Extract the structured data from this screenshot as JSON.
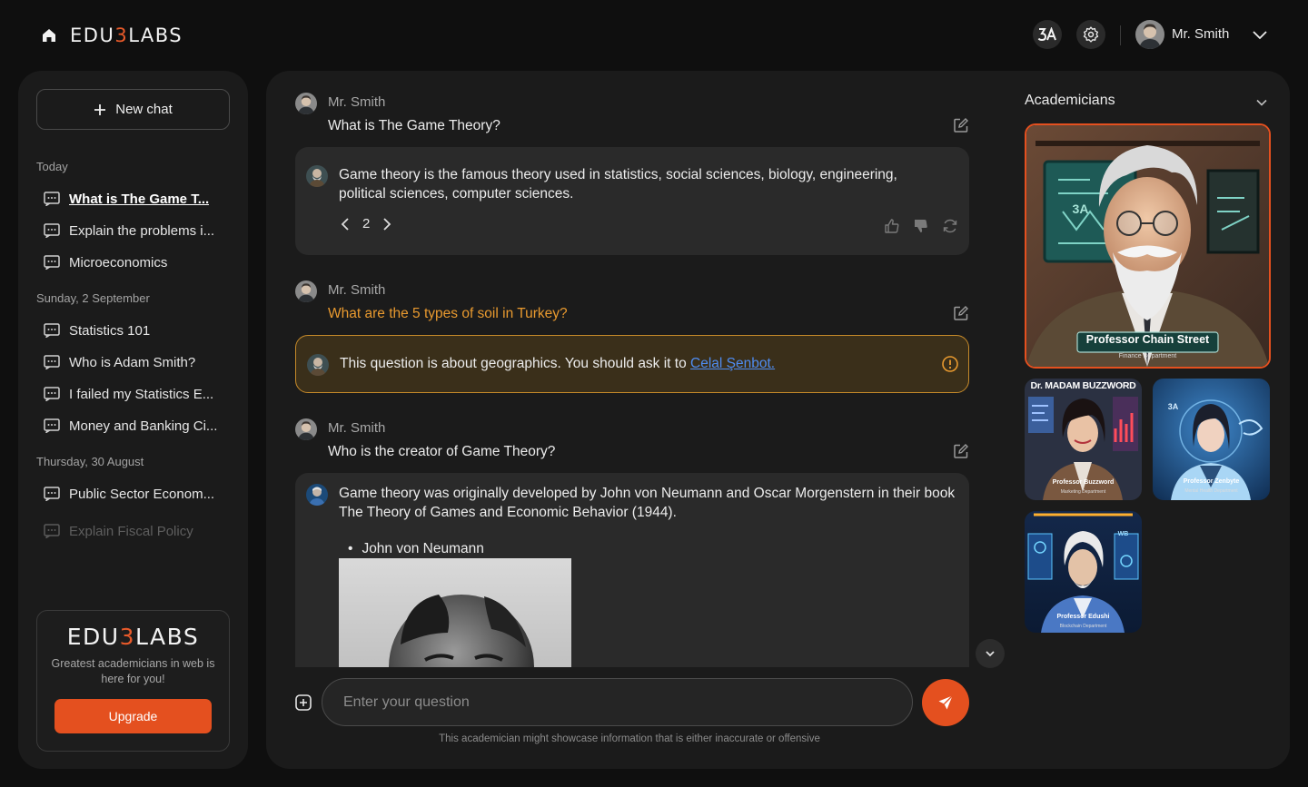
{
  "header": {
    "logo_left": "EDU",
    "logo_mid": "3",
    "logo_right": "LABS",
    "user_name": "Mr. Smith"
  },
  "sidebar": {
    "new_chat_label": "New chat",
    "sections": [
      {
        "label": "Today",
        "items": [
          "What is The Game T...",
          "Explain the problems i...",
          "Microeconomics"
        ]
      },
      {
        "label": "Sunday, 2 September",
        "items": [
          "Statistics 101",
          "Who is Adam Smith?",
          "I failed my Statistics E...",
          "Money and Banking Ci..."
        ]
      },
      {
        "label": "Thursday, 30 August",
        "items": [
          "Public Sector Econom...",
          "Explain Fiscal Policy"
        ]
      }
    ],
    "upgrade": {
      "logo_left": "EDU",
      "logo_mid": "3",
      "logo_right": "LABS",
      "text": "Greatest academicians in web is here for you!",
      "button": "Upgrade"
    }
  },
  "chat": {
    "messages": [
      {
        "author": "Mr. Smith",
        "question": "What is The Game Theory?",
        "answer": "Game theory is the famous theory used in statistics, social sciences, biology, engineering, political sciences, computer sciences.",
        "page": "2"
      },
      {
        "author": "Mr. Smith",
        "question": "What are the 5 types of soil in Turkey?",
        "warning_text": "This question is about geographics. You should ask it to ",
        "warning_link": "Celal Şenbot."
      },
      {
        "author": "Mr. Smith",
        "question": "Who is the creator of Game Theory?",
        "answer": "Game theory was originally developed by John von Neumann and Oscar Morgenstern in their book The Theory of Games and Economic Behavior (1944).",
        "bullet": "John von Neumann"
      }
    ],
    "input_placeholder": "Enter your question",
    "disclaimer": "This academician might showcase information that is either inaccurate or offensive"
  },
  "academicians": {
    "title": "Academicians",
    "cards": [
      {
        "name": "Professor Chain Street",
        "dept": "Finance Department",
        "badge": "3A"
      },
      {
        "name": "Professor Buzzword",
        "dept": "Marketing Department",
        "header": "Dr. MADAM BUZZWORD"
      },
      {
        "name": "Professor Zenbyte",
        "dept": "Mental Health Department",
        "badge": "3A"
      },
      {
        "name": "Professor Edushi",
        "dept": "Blockchain Department",
        "badge": "WB"
      }
    ]
  },
  "colors": {
    "accent": "#e4501f",
    "warning_border": "#c68a2a",
    "warning_text": "#e99a2f",
    "link": "#4f8cf0",
    "panel_bg": "#1b1b1b",
    "page_bg": "#0f0f0f"
  }
}
